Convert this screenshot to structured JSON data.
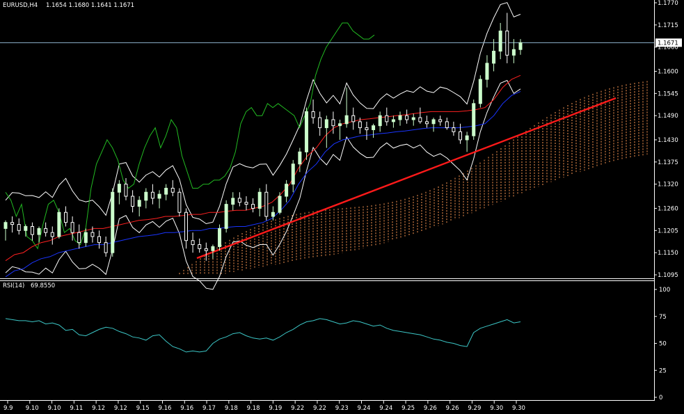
{
  "header": {
    "symbol_label": "EURUSD,H4",
    "ohlc": "1.1654 1.1680 1.1641 1.1671"
  },
  "price_marker": "1.1671",
  "rsi_header": {
    "label": "RSI(14)",
    "value": "69.8550"
  },
  "colors": {
    "background": "#000000",
    "axis": "#ffffff",
    "bullish_candle": "#ccffcc",
    "bearish_candle": "#ffffff",
    "green_line": "#22bb22",
    "red_line": "#ff2020",
    "blue_line": "#1a35ff",
    "envelope": "#ffffff",
    "cloud": "#ff9a55",
    "trendline": "#ff1a1a",
    "rsi_line": "#3cc7c7",
    "current_price_line": "#8fb4d0"
  },
  "chart_data": [
    {
      "type": "candlestick",
      "title": "EURUSD,H4",
      "ylim": [
        1.1095,
        1.177
      ],
      "y_ticks": [
        "1.1770",
        "1.1715",
        "1.1660",
        "1.1600",
        "1.1545",
        "1.1490",
        "1.1430",
        "1.1375",
        "1.1320",
        "1.1260",
        "1.1205",
        "1.1150",
        "1.1095"
      ],
      "x_ticks": [
        "9.9",
        "9.10",
        "9.10",
        "9.11",
        "9.12",
        "9.12",
        "9.15",
        "9.16",
        "9.16",
        "9.17",
        "9.18",
        "9.18",
        "9.19",
        "9.22",
        "9.22",
        "9.23",
        "9.24",
        "9.24",
        "9.25",
        "9.26",
        "9.26",
        "9.29",
        "9.30",
        "9.30"
      ],
      "current_price": 1.1671,
      "candles": [
        [
          1.121,
          1.123,
          1.118,
          1.1225
        ],
        [
          1.1225,
          1.124,
          1.12,
          1.122
        ],
        [
          1.122,
          1.1235,
          1.1195,
          1.1205
        ],
        [
          1.1205,
          1.122,
          1.119,
          1.1215
        ],
        [
          1.1215,
          1.1225,
          1.118,
          1.1195
        ],
        [
          1.1195,
          1.1215,
          1.1175,
          1.121
        ],
        [
          1.121,
          1.1225,
          1.119,
          1.12
        ],
        [
          1.12,
          1.1215,
          1.117,
          1.119
        ],
        [
          1.119,
          1.126,
          1.1185,
          1.125
        ],
        [
          1.125,
          1.1265,
          1.1215,
          1.1225
        ],
        [
          1.1225,
          1.124,
          1.118,
          1.12
        ],
        [
          1.12,
          1.122,
          1.116,
          1.1175
        ],
        [
          1.1175,
          1.121,
          1.1165,
          1.12
        ],
        [
          1.12,
          1.1215,
          1.1175,
          1.119
        ],
        [
          1.119,
          1.1205,
          1.116,
          1.1175
        ],
        [
          1.1175,
          1.119,
          1.114,
          1.115
        ],
        [
          1.115,
          1.131,
          1.114,
          1.13
        ],
        [
          1.13,
          1.133,
          1.127,
          1.132
        ],
        [
          1.132,
          1.1335,
          1.128,
          1.129
        ],
        [
          1.129,
          1.1305,
          1.125,
          1.1265
        ],
        [
          1.1265,
          1.129,
          1.124,
          1.128
        ],
        [
          1.128,
          1.131,
          1.126,
          1.13
        ],
        [
          1.13,
          1.132,
          1.127,
          1.1285
        ],
        [
          1.1285,
          1.1305,
          1.126,
          1.1295
        ],
        [
          1.1295,
          1.132,
          1.128,
          1.131
        ],
        [
          1.131,
          1.133,
          1.129,
          1.13
        ],
        [
          1.13,
          1.131,
          1.124,
          1.125
        ],
        [
          1.125,
          1.126,
          1.116,
          1.118
        ],
        [
          1.118,
          1.12,
          1.115,
          1.117
        ],
        [
          1.117,
          1.1185,
          1.115,
          1.116
        ],
        [
          1.116,
          1.1175,
          1.113,
          1.1155
        ],
        [
          1.1155,
          1.117,
          1.1135,
          1.1165
        ],
        [
          1.1165,
          1.122,
          1.1155,
          1.121
        ],
        [
          1.121,
          1.128,
          1.12,
          1.127
        ],
        [
          1.127,
          1.13,
          1.1255,
          1.1285
        ],
        [
          1.1285,
          1.13,
          1.1265,
          1.1275
        ],
        [
          1.1275,
          1.129,
          1.1255,
          1.127
        ],
        [
          1.127,
          1.1285,
          1.125,
          1.126
        ],
        [
          1.126,
          1.131,
          1.124,
          1.13
        ],
        [
          1.13,
          1.132,
          1.123,
          1.124
        ],
        [
          1.124,
          1.1265,
          1.123,
          1.125
        ],
        [
          1.125,
          1.13,
          1.1245,
          1.129
        ],
        [
          1.129,
          1.133,
          1.1275,
          1.132
        ],
        [
          1.132,
          1.138,
          1.13,
          1.137
        ],
        [
          1.137,
          1.141,
          1.135,
          1.14
        ],
        [
          1.14,
          1.151,
          1.138,
          1.15
        ],
        [
          1.15,
          1.153,
          1.147,
          1.1485
        ],
        [
          1.1485,
          1.15,
          1.144,
          1.146
        ],
        [
          1.146,
          1.149,
          1.141,
          1.148
        ],
        [
          1.148,
          1.15,
          1.1445,
          1.1465
        ],
        [
          1.1465,
          1.148,
          1.143,
          1.147
        ],
        [
          1.147,
          1.156,
          1.146,
          1.149
        ],
        [
          1.149,
          1.151,
          1.1455,
          1.1475
        ],
        [
          1.1475,
          1.1485,
          1.1445,
          1.146
        ],
        [
          1.146,
          1.1475,
          1.143,
          1.1455
        ],
        [
          1.1455,
          1.147,
          1.1435,
          1.1465
        ],
        [
          1.1465,
          1.15,
          1.145,
          1.149
        ],
        [
          1.149,
          1.151,
          1.1465,
          1.1475
        ],
        [
          1.1475,
          1.149,
          1.146,
          1.148
        ],
        [
          1.148,
          1.15,
          1.1465,
          1.149
        ],
        [
          1.149,
          1.1505,
          1.147,
          1.148
        ],
        [
          1.148,
          1.1495,
          1.1465,
          1.1485
        ],
        [
          1.1485,
          1.151,
          1.147,
          1.1475
        ],
        [
          1.1475,
          1.149,
          1.146,
          1.147
        ],
        [
          1.147,
          1.1485,
          1.145,
          1.148
        ],
        [
          1.148,
          1.149,
          1.1465,
          1.1475
        ],
        [
          1.1475,
          1.1485,
          1.1455,
          1.146
        ],
        [
          1.146,
          1.1475,
          1.144,
          1.145
        ],
        [
          1.145,
          1.147,
          1.142,
          1.143
        ],
        [
          1.143,
          1.145,
          1.14,
          1.144
        ],
        [
          1.144,
          1.153,
          1.143,
          1.152
        ],
        [
          1.152,
          1.159,
          1.151,
          1.158
        ],
        [
          1.158,
          1.164,
          1.156,
          1.162
        ],
        [
          1.162,
          1.168,
          1.16,
          1.165
        ],
        [
          1.165,
          1.172,
          1.163,
          1.17
        ],
        [
          1.17,
          1.1745,
          1.162,
          1.164
        ],
        [
          1.164,
          1.168,
          1.162,
          1.1654
        ],
        [
          1.1654,
          1.168,
          1.1641,
          1.1671
        ]
      ],
      "lines": {
        "green": [
          1.13,
          1.128,
          1.124,
          1.127,
          1.119,
          1.118,
          1.116,
          1.122,
          1.127,
          1.128,
          1.125,
          1.12,
          1.121,
          1.118,
          1.117,
          1.121,
          1.131,
          1.137,
          1.14,
          1.143,
          1.141,
          1.138,
          1.133,
          1.131,
          1.132,
          1.137,
          1.141,
          1.144,
          1.146,
          1.141,
          1.144,
          1.148,
          1.146,
          1.139,
          1.135,
          1.131,
          1.131,
          1.132,
          1.132,
          1.133,
          1.133,
          1.134,
          1.136,
          1.14,
          1.147,
          1.15,
          1.151,
          1.149,
          1.149,
          1.152,
          1.151,
          1.152,
          1.151,
          1.15,
          1.149,
          1.146,
          1.149,
          1.152,
          1.159,
          1.163,
          1.166,
          1.168,
          1.17,
          1.172,
          1.172,
          1.17,
          1.169,
          1.168,
          1.168,
          1.169
        ],
        "red": [
          1.113,
          1.1145,
          1.115,
          1.1165,
          1.1175,
          1.118,
          1.119,
          1.1195,
          1.12,
          1.1205,
          1.121,
          1.121,
          1.1215,
          1.122,
          1.1225,
          1.123,
          1.1232,
          1.1235,
          1.124,
          1.124,
          1.1242,
          1.1245,
          1.1245,
          1.125,
          1.125,
          1.1253,
          1.1255,
          1.1255,
          1.126,
          1.1265,
          1.1275,
          1.1295,
          1.132,
          1.136,
          1.139,
          1.141,
          1.144,
          1.146,
          1.147,
          1.1475,
          1.148,
          1.1482,
          1.1485,
          1.1487,
          1.149,
          1.1492,
          1.1495,
          1.1498,
          1.15,
          1.15,
          1.15,
          1.15,
          1.1502,
          1.1505,
          1.151,
          1.153,
          1.156,
          1.158,
          1.159
        ]
      }
    },
    {
      "type": "line",
      "title": "RSI(14) 69.8550",
      "ylim": [
        0,
        100
      ],
      "y_ticks": [
        "100",
        "75",
        "50",
        "25",
        "0"
      ],
      "series": [
        {
          "values": [
            73,
            72,
            71,
            71,
            70,
            71,
            68,
            69,
            67,
            62,
            63,
            58,
            57,
            60,
            63,
            65,
            64,
            61,
            59,
            56,
            55,
            53,
            57,
            58,
            52,
            47,
            45,
            42,
            43,
            42,
            43,
            50,
            54,
            56,
            59,
            60,
            57,
            55,
            54,
            55,
            53,
            56,
            60,
            63,
            67,
            70,
            71,
            73,
            72,
            70,
            68,
            69,
            71,
            70,
            68,
            66,
            67,
            64,
            62,
            61,
            60,
            59,
            58,
            56,
            54,
            53,
            51,
            50,
            48,
            47,
            60,
            64,
            66,
            68,
            70,
            72,
            69,
            70
          ]
        }
      ]
    }
  ]
}
